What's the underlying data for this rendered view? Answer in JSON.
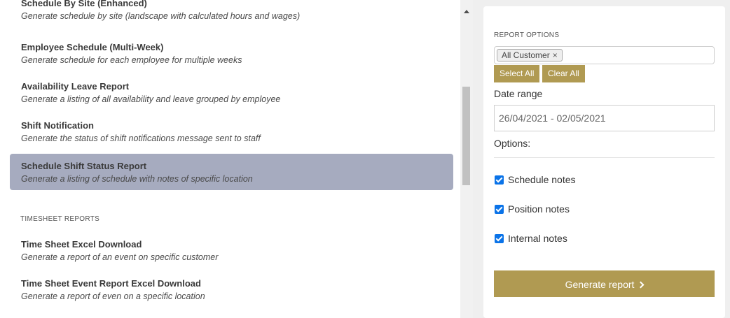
{
  "schedule_reports": [
    {
      "title": "Schedule By Site (Enhanced)",
      "description": "Generate schedule by site (landscape with calculated hours and wages)"
    },
    {
      "title": "Employee Schedule (Multi-Week)",
      "description": "Generate schedule for each employee for multiple weeks"
    },
    {
      "title": "Availability Leave Report",
      "description": "Generate a listing of all availability and leave grouped by employee"
    },
    {
      "title": "Shift Notification",
      "description": "Generate the status of shift notifications message sent to staff"
    },
    {
      "title": "Schedule Shift Status Report",
      "description": "Generate a listing of schedule with notes of specific location"
    }
  ],
  "timesheet_heading": "TIMESHEET REPORTS",
  "timesheet_reports": [
    {
      "title": "Time Sheet Excel Download",
      "description": "Generate a report of an event on specific customer"
    },
    {
      "title": "Time Sheet Event Report Excel Download",
      "description": "Generate a report of even on a specific location"
    }
  ],
  "report_options": {
    "heading": "REPORT OPTIONS",
    "tag": "All Customer",
    "select_all": "Select All",
    "clear_all": "Clear All",
    "date_range_label": "Date range",
    "date_range_value": "26/04/2021 - 02/05/2021",
    "options_label": "Options:",
    "checkboxes": [
      {
        "label": "Schedule notes",
        "checked": true
      },
      {
        "label": "Position notes",
        "checked": true
      },
      {
        "label": "Internal notes",
        "checked": true
      }
    ],
    "generate_label": "Generate report"
  },
  "colors": {
    "accent": "#b09a52",
    "selected_row": "#a6abbf",
    "checkbox": "#0a73e8"
  }
}
